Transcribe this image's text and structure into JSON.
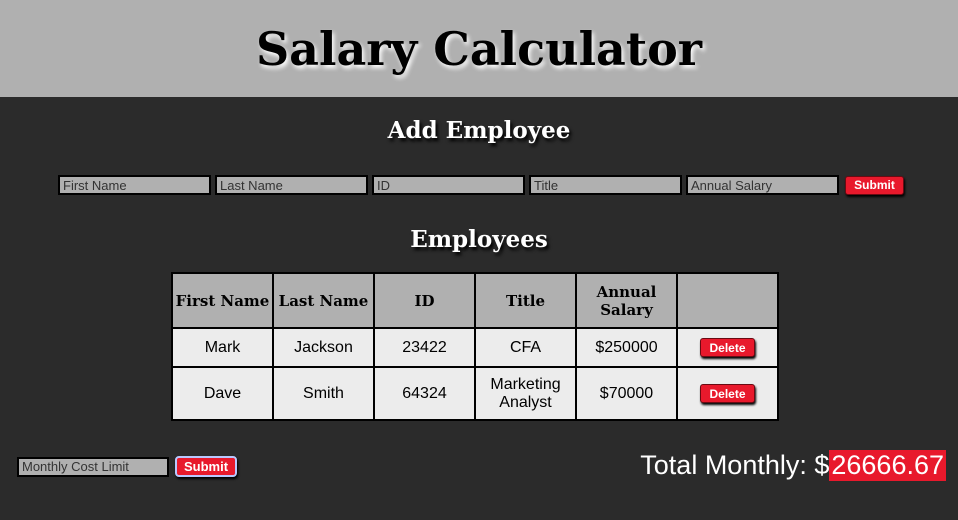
{
  "header": {
    "title": "Salary Calculator"
  },
  "add_section": {
    "title": "Add Employee",
    "placeholders": {
      "first_name": "First Name",
      "last_name": "Last Name",
      "id": "ID",
      "title": "Title",
      "annual_salary": "Annual Salary"
    },
    "submit_label": "Submit"
  },
  "employees_section": {
    "title": "Employees",
    "columns": [
      "First Name",
      "Last Name",
      "ID",
      "Title",
      "Annual Salary",
      ""
    ],
    "rows": [
      {
        "first": "Mark",
        "last": "Jackson",
        "id": "23422",
        "title": "CFA",
        "salary": "$250000",
        "action": "Delete"
      },
      {
        "first": "Dave",
        "last": "Smith",
        "id": "64324",
        "title": "Marketing Analyst",
        "salary": "$70000",
        "action": "Delete"
      }
    ]
  },
  "cost_limit": {
    "placeholder": "Monthly Cost Limit",
    "submit_label": "Submit"
  },
  "total": {
    "label": "Total Monthly: $",
    "value": "26666.67"
  },
  "colors": {
    "header_bg": "#b0b0b0",
    "page_bg": "#2b2b2b",
    "accent_red": "#e8192c",
    "cell_bg": "#ececec"
  }
}
